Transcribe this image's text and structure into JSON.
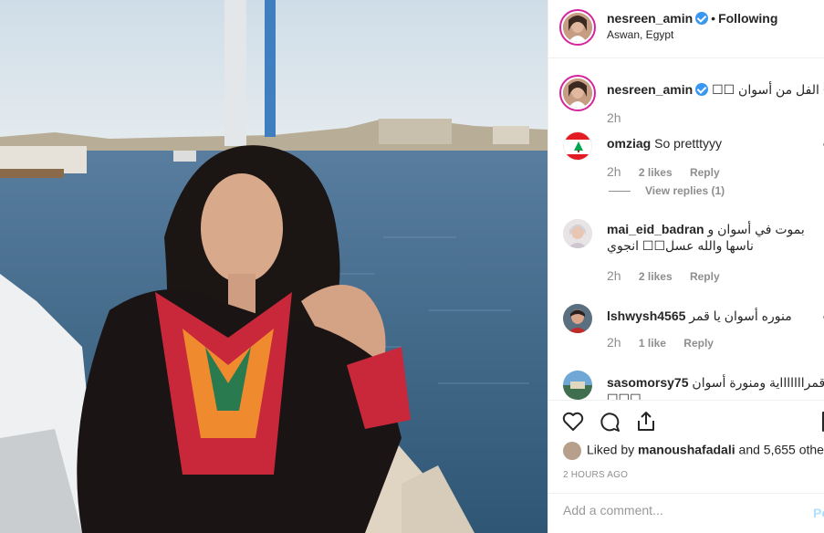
{
  "post": {
    "username": "nesreen_amin",
    "follow_status": "Following",
    "separator": "•",
    "location": "Aswan, Egypt"
  },
  "caption": {
    "username": "nesreen_amin",
    "text": "صباح الفل من أسوان ☐☐",
    "time": "2h"
  },
  "comments": [
    {
      "username": "omziag",
      "text": "So pretttyyy",
      "time": "2h",
      "likes": "2 likes",
      "reply": "Reply",
      "view_replies": "View replies (1)"
    },
    {
      "username": "mai_eid_badran",
      "text": "بموت في أسوان و ناسها والله عسل☐☐ انجوي",
      "time": "2h",
      "likes": "2 likes",
      "reply": "Reply"
    },
    {
      "username": "lshwysh4565",
      "text": "منوره أسوان يا قمر",
      "time": "2h",
      "likes": "1 like",
      "reply": "Reply"
    },
    {
      "username": "sasomorsy75",
      "text": "قمراااااااية ومنورة أسوان ☐☐☐"
    }
  ],
  "likes": {
    "prefix": "Liked by",
    "user": "manoushafadali",
    "suffix": "and 5,655 other"
  },
  "timestamp": "2 HOURS AGO",
  "add_comment": {
    "placeholder": "Add a comment...",
    "post_label": "Po"
  },
  "colors": {
    "accent_blue": "#3897f0",
    "post_disabled": "#b2dffc",
    "muted": "#8e8e8e",
    "text": "#262626"
  },
  "icons": [
    "verified-badge-icon",
    "heart-icon",
    "comment-icon",
    "share-icon",
    "bookmark-icon"
  ]
}
